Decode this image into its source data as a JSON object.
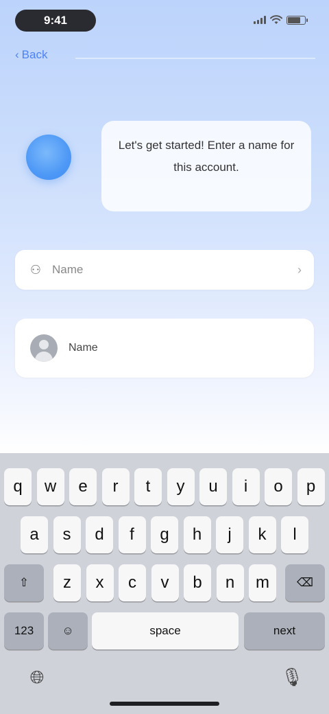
{
  "status_bar": {
    "time": "9:41"
  },
  "nav": {
    "back_label": "Back"
  },
  "assistant": {
    "bubble_text": "Let's get started! Enter a name for this account."
  },
  "field": {
    "placeholder": "Name",
    "value": ""
  },
  "account": {
    "name": "Name"
  },
  "keyboard": {
    "row1": [
      "q",
      "w",
      "e",
      "r",
      "t",
      "y",
      "u",
      "i",
      "o",
      "p"
    ],
    "row2": [
      "a",
      "s",
      "d",
      "f",
      "g",
      "h",
      "j",
      "k",
      "l"
    ],
    "row3": [
      "z",
      "x",
      "c",
      "v",
      "b",
      "n",
      "m"
    ],
    "shift_label": "⇧",
    "delete_label": "⌫",
    "numbers_label": "123",
    "emoji_label": "☺",
    "space_label": "space",
    "return_label": "next"
  },
  "colors": {
    "accent": "#4e83f5",
    "gradient_top": "#bcd3fb",
    "keyboard_bg": "#cfd2d8"
  }
}
